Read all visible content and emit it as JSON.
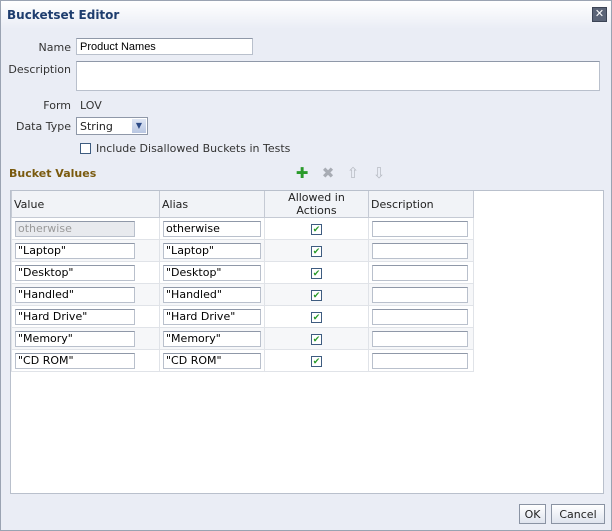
{
  "dialog": {
    "title": "Bucketset Editor",
    "close_icon": "close-icon"
  },
  "form": {
    "name_label": "Name",
    "name_value": "Product Names",
    "description_label": "Description",
    "description_value": "",
    "form_label": "Form",
    "form_value": "LOV",
    "data_type_label": "Data Type",
    "data_type_value": "String",
    "include_disallowed_label": "Include Disallowed Buckets in Tests",
    "include_disallowed_checked": false
  },
  "bucket_values": {
    "title": "Bucket Values",
    "toolbar": [
      "add-icon",
      "delete-icon",
      "move-up-icon",
      "move-down-icon"
    ],
    "columns": [
      "Value",
      "Alias",
      "Allowed in Actions",
      "Description"
    ],
    "rows": [
      {
        "value": "otherwise",
        "alias": "otherwise",
        "allowed": true,
        "description": "",
        "value_disabled": true
      },
      {
        "value": "\"Laptop\"",
        "alias": "\"Laptop\"",
        "allowed": true,
        "description": ""
      },
      {
        "value": "\"Desktop\"",
        "alias": "\"Desktop\"",
        "allowed": true,
        "description": ""
      },
      {
        "value": "\"Handled\"",
        "alias": "\"Handled\"",
        "allowed": true,
        "description": ""
      },
      {
        "value": "\"Hard Drive\"",
        "alias": "\"Hard Drive\"",
        "allowed": true,
        "description": ""
      },
      {
        "value": "\"Memory\"",
        "alias": "\"Memory\"",
        "allowed": true,
        "description": ""
      },
      {
        "value": "\"CD ROM\"",
        "alias": "\"CD ROM\"",
        "allowed": true,
        "description": ""
      }
    ]
  },
  "buttons": {
    "ok": "OK",
    "cancel": "Cancel"
  }
}
